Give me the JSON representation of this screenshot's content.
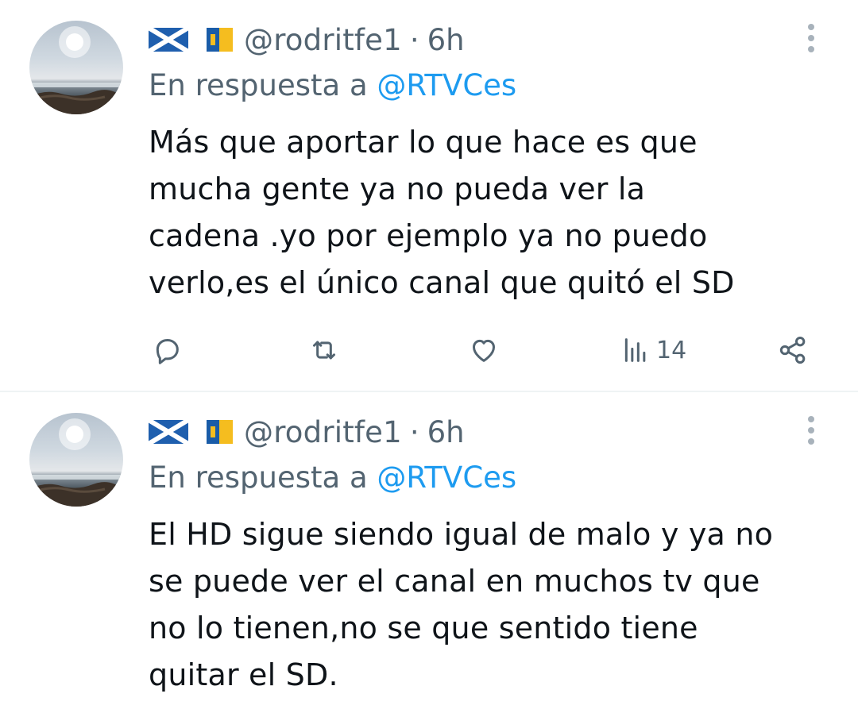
{
  "tweets": [
    {
      "username": "@rodritfe1",
      "separator": "·",
      "time": "6h",
      "reply_prefix": "En respuesta a",
      "reply_handle": "@RTVCes",
      "text": "Más que aportar lo que hace es que\nmucha gente ya no pueda ver la\ncadena .yo por ejemplo ya no puedo\nverlo,es el único canal que quitó el SD",
      "views_count": "14",
      "flags": [
        "scotland-flag",
        "canary-islands-flag"
      ]
    },
    {
      "username": "@rodritfe1",
      "separator": "·",
      "time": "6h",
      "reply_prefix": "En respuesta a",
      "reply_handle": "@RTVCes",
      "text": "El HD sigue siendo igual de malo y ya no\nse puede ver el canal en muchos tv que\nno lo tienen,no se que sentido tiene\nquitar el SD.",
      "flags": [
        "scotland-flag",
        "canary-islands-flag"
      ]
    }
  ],
  "colors": {
    "secondary": "#536471",
    "link": "#1d9bf0",
    "text": "#0f1419",
    "divider": "#eff3f4"
  },
  "icons": [
    "reply-icon",
    "retweet-icon",
    "like-icon",
    "views-icon",
    "share-icon",
    "more-icon"
  ]
}
